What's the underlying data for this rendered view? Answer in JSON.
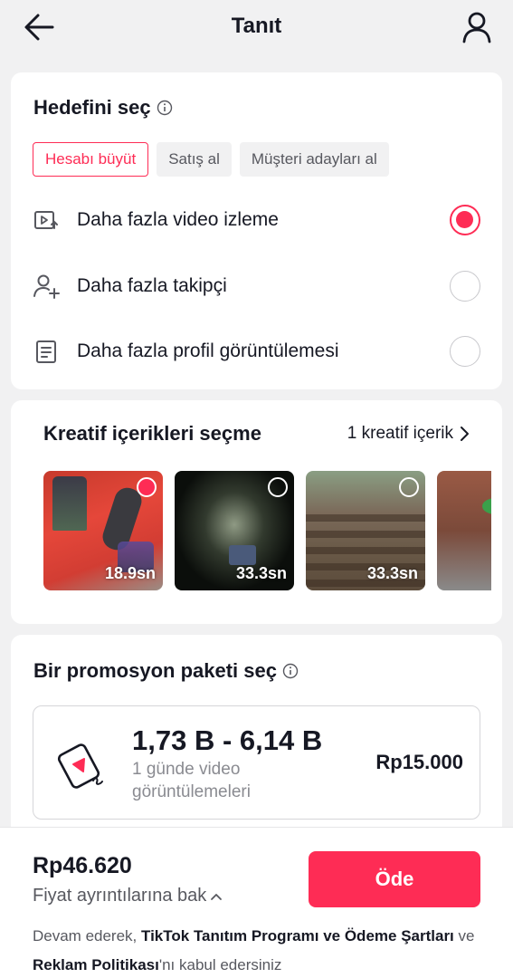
{
  "header": {
    "title": "Tanıt"
  },
  "goal": {
    "title": "Hedefini seç",
    "chips": [
      "Hesabı büyüt",
      "Satış al",
      "Müşteri adayları al"
    ],
    "options": [
      {
        "label": "Daha fazla video izleme",
        "icon": "video-play-icon",
        "selected": true
      },
      {
        "label": "Daha fazla takipçi",
        "icon": "add-follower-icon",
        "selected": false
      },
      {
        "label": "Daha fazla profil görüntülemesi",
        "icon": "profile-card-icon",
        "selected": false
      }
    ]
  },
  "creative": {
    "title": "Kreatif içerikleri seçme",
    "link": "1 kreatif içerik",
    "thumbnails": [
      {
        "duration": "18.9sn",
        "selected": true
      },
      {
        "duration": "33.3sn",
        "selected": false
      },
      {
        "duration": "33.3sn",
        "selected": false
      },
      {
        "duration": "",
        "selected": false
      }
    ]
  },
  "promo": {
    "title": "Bir promosyon paketi seç",
    "package": {
      "range": "1,73 B - 6,14 B",
      "description": "1 günde video görüntülemeleri",
      "price": "Rp15.000"
    }
  },
  "footer": {
    "total": "Rp46.620",
    "details": "Fiyat ayrıntılarına bak",
    "pay": "Öde",
    "legal_1": "Devam ederek, ",
    "legal_link_1": "TikTok Tanıtım Programı ve Ödeme Şartları",
    "legal_2": " ve ",
    "legal_link_2": "Reklam Politikası",
    "legal_3": "'nı kabul edersiniz"
  },
  "colors": {
    "accent": "#fe2c55",
    "background": "#f1f1f2",
    "text": "#161823",
    "muted": "#8a8b91"
  }
}
